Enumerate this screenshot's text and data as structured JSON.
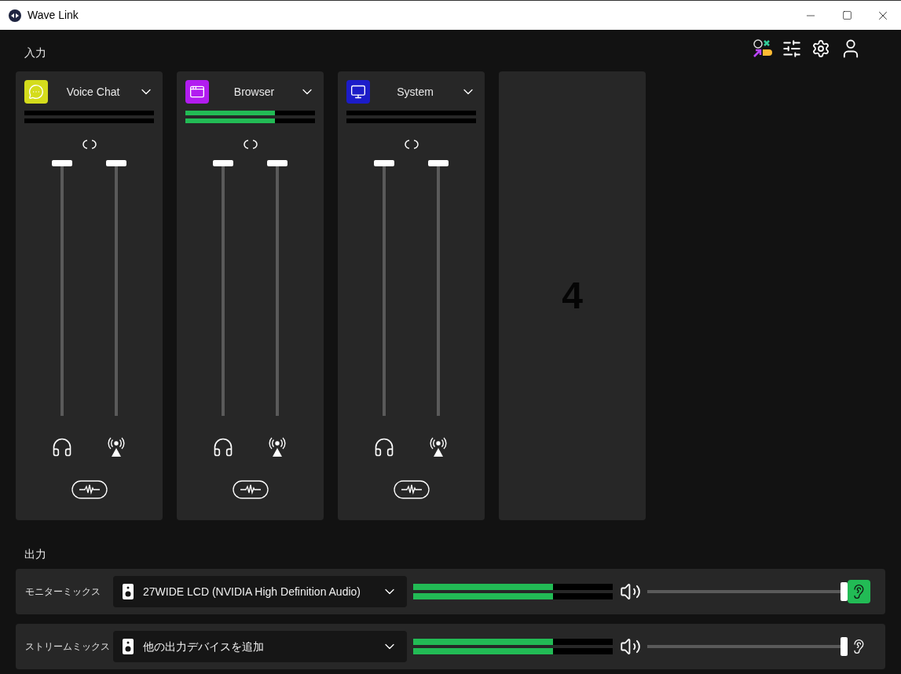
{
  "window": {
    "title": "Wave Link"
  },
  "inputs": {
    "heading": "入力",
    "channels": [
      {
        "name": "Voice Chat",
        "kind": "chat",
        "color": "#d4dc1c",
        "meter": {
          "level": 0
        },
        "monitor_fader": {
          "level": 1
        },
        "stream_fader": {
          "level": 1
        }
      },
      {
        "name": "Browser",
        "kind": "browser",
        "color": "#b21cf0",
        "meter": {
          "level": 0.69
        },
        "monitor_fader": {
          "level": 1
        },
        "stream_fader": {
          "level": 1
        }
      },
      {
        "name": "System",
        "kind": "system",
        "color": "#1c1cc8",
        "meter": {
          "level": 0
        },
        "monitor_fader": {
          "level": 1
        },
        "stream_fader": {
          "level": 1
        }
      }
    ],
    "empty_slot": "4"
  },
  "outputs": {
    "heading": "出力",
    "mixes": [
      {
        "label": "モニターミックス",
        "device": "27WIDE LCD (NVIDIA High Definition Audio)",
        "meter": {
          "level": 0.7
        },
        "volume": {
          "level": 1
        },
        "listening": true
      },
      {
        "label": "ストリームミックス",
        "device": "他の出力デバイスを追加",
        "meter": {
          "level": 0.7
        },
        "volume": {
          "level": 1
        },
        "listening": false
      }
    ]
  }
}
